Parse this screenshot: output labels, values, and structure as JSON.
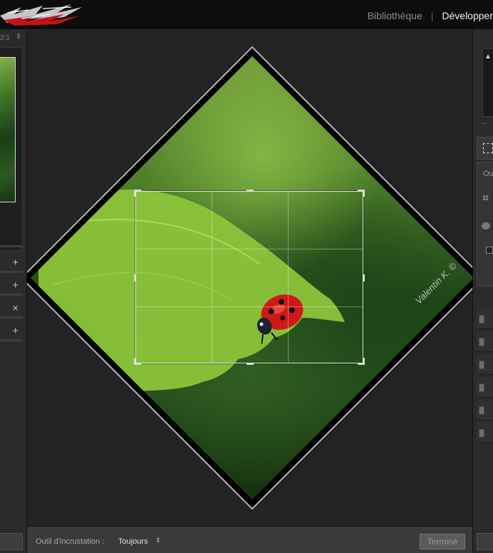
{
  "header": {
    "modules": [
      {
        "label": "Bibliothèque",
        "active": false
      },
      {
        "label": "Développer",
        "active": true
      }
    ],
    "separator": "|"
  },
  "navigator": {
    "zoom_label": "2:1",
    "zoom_arrow": "⇕"
  },
  "left_panel": {
    "rows": [
      {
        "icon": "plus-icon",
        "glyph": "+"
      },
      {
        "icon": "plus-icon",
        "glyph": "+"
      },
      {
        "icon": "close-icon",
        "glyph": "×"
      },
      {
        "icon": "add-preset-icon",
        "glyph": "+"
      }
    ]
  },
  "image": {
    "watermark": "Valentin K. ©"
  },
  "toolbar": {
    "tool_overlay_label": "Outil d'incrustation :",
    "tool_overlay_value": "Toujours",
    "tool_overlay_arrow": "⇕",
    "done_label": "Terminé"
  },
  "right_panel": {
    "hist_triangle": "▲",
    "hist_minus": "–",
    "label_truncated": "Ou",
    "crop_glyph": "⌗"
  },
  "colors": {
    "accent_active": "#f1f1f1",
    "module_inactive": "#8e8e8e",
    "panel_bg": "#2b2b2b",
    "canvas_bg": "#232323"
  }
}
